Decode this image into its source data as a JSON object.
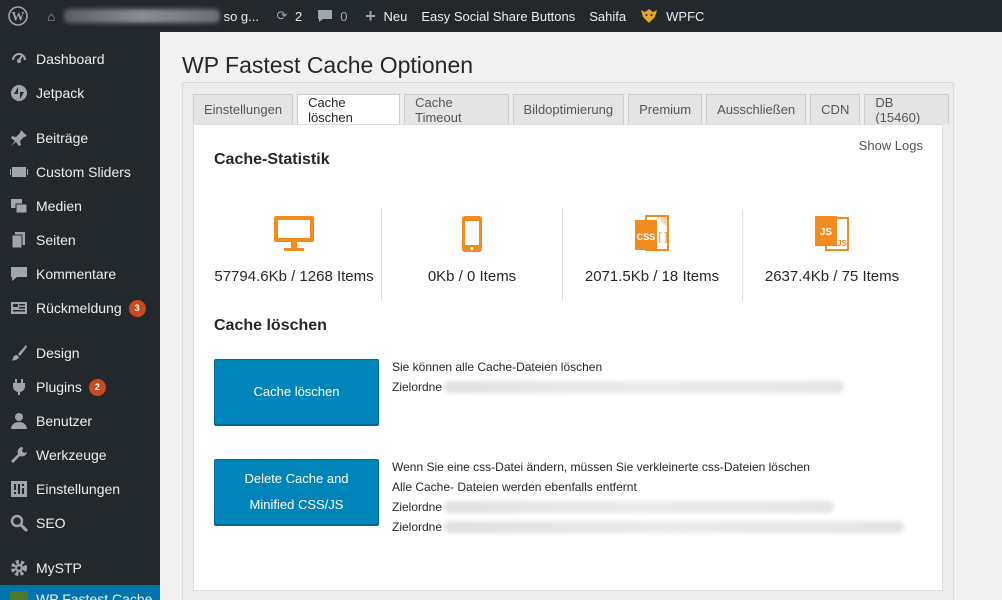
{
  "adminbar": {
    "site_name_suffix": "so g...",
    "updates_count": "2",
    "comments_count": "0",
    "new_label": "Neu",
    "plugin_link": "Easy Social Share Buttons",
    "theme_link": "Sahifa",
    "wpfc_label": "WPFC"
  },
  "sidebar": {
    "items": [
      {
        "label": "Dashboard",
        "icon": "dashboard-icon"
      },
      {
        "label": "Jetpack",
        "icon": "jetpack-icon"
      },
      {
        "label": "Beiträge",
        "icon": "pin-icon"
      },
      {
        "label": "Custom Sliders",
        "icon": "slider-icon"
      },
      {
        "label": "Medien",
        "icon": "media-icon"
      },
      {
        "label": "Seiten",
        "icon": "pages-icon"
      },
      {
        "label": "Kommentare",
        "icon": "comment-icon"
      },
      {
        "label": "Rückmeldung",
        "icon": "feedback-icon",
        "badge": "3"
      },
      {
        "label": "Design",
        "icon": "brush-icon"
      },
      {
        "label": "Plugins",
        "icon": "plugin-icon",
        "badge": "2"
      },
      {
        "label": "Benutzer",
        "icon": "user-icon"
      },
      {
        "label": "Werkzeuge",
        "icon": "wrench-icon"
      },
      {
        "label": "Einstellungen",
        "icon": "settings-icon"
      },
      {
        "label": "SEO",
        "icon": "search-icon"
      },
      {
        "label": "MySTP",
        "icon": "gear-icon"
      },
      {
        "label": "WP Fastest Cache",
        "icon": "wpfc-icon"
      }
    ]
  },
  "page": {
    "title": "WP Fastest Cache Optionen"
  },
  "tabs": [
    {
      "label": "Einstellungen"
    },
    {
      "label": "Cache löschen",
      "active": true
    },
    {
      "label": "Cache Timeout"
    },
    {
      "label": "Bildoptimierung"
    },
    {
      "label": "Premium"
    },
    {
      "label": "Ausschließen"
    },
    {
      "label": "CDN"
    },
    {
      "label": "DB (15460)"
    }
  ],
  "panel": {
    "show_logs": "Show Logs",
    "stats_title": "Cache-Statistik",
    "stats": [
      {
        "icon": "desktop-icon",
        "value": "57794.6Kb / 1268 Items"
      },
      {
        "icon": "mobile-icon",
        "value": "0Kb / 0 Items"
      },
      {
        "icon": "css-file-icon",
        "value": "2071.5Kb / 18 Items",
        "icon_text": "CSS"
      },
      {
        "icon": "js-file-icon",
        "value": "2637.4Kb / 75 Items",
        "icon_text": "JS"
      }
    ],
    "clear_title": "Cache löschen",
    "clear_button": "Cache löschen",
    "clear_desc": [
      "Sie können alle Cache-Dateien löschen",
      "Zielordne"
    ],
    "minified_button_line1": "Delete Cache and",
    "minified_button_line2": "Minified CSS/JS",
    "minified_desc": [
      "Wenn Sie eine css-Datei ändern, müssen Sie verkleinerte css-Dateien löschen",
      "Alle Cache- Dateien werden ebenfalls entfernt",
      "Zielordne",
      "Zielordne"
    ]
  },
  "colors": {
    "accent_orange": "#f48b1f",
    "button_blue": "#0085ba",
    "admin_dark": "#23282d",
    "badge_red": "#ca4a1f"
  }
}
